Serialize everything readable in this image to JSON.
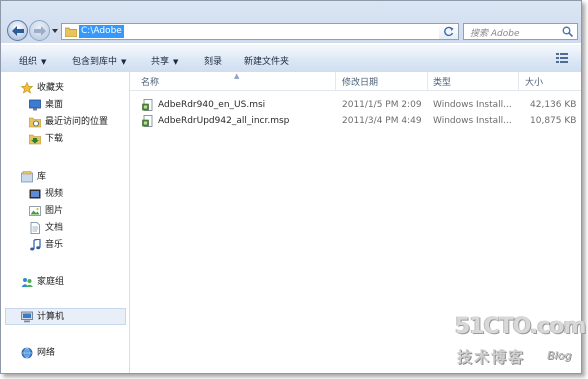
{
  "address_bar": {
    "path": "C:\\Adobe"
  },
  "search": {
    "placeholder": "搜索 Adobe"
  },
  "toolbar": {
    "organize": "组织",
    "include_in_library": "包含到库中",
    "share": "共享",
    "burn": "刻录",
    "new_folder": "新建文件夹"
  },
  "nav_pane": {
    "favorites": {
      "label": "收藏夹",
      "items": [
        "桌面",
        "最近访问的位置",
        "下载"
      ]
    },
    "libraries": {
      "label": "库",
      "items": [
        "视频",
        "图片",
        "文档",
        "音乐"
      ]
    },
    "homegroup": "家庭组",
    "computer": "计算机",
    "network": "网络"
  },
  "file_list": {
    "columns": [
      "名称",
      "修改日期",
      "类型",
      "大小"
    ],
    "rows": [
      {
        "name": "AdbeRdr940_en_US.msi",
        "date": "2011/1/5 PM 2:09",
        "type": "Windows Install...",
        "size": "42,136 KB"
      },
      {
        "name": "AdbeRdrUpd942_all_incr.msp",
        "date": "2011/3/4 PM 4:49",
        "type": "Windows Install...",
        "size": "10,875 KB"
      }
    ]
  },
  "watermark": {
    "logo": "51CTO.com",
    "subtitle": "技术博客",
    "blog": "Blog"
  }
}
